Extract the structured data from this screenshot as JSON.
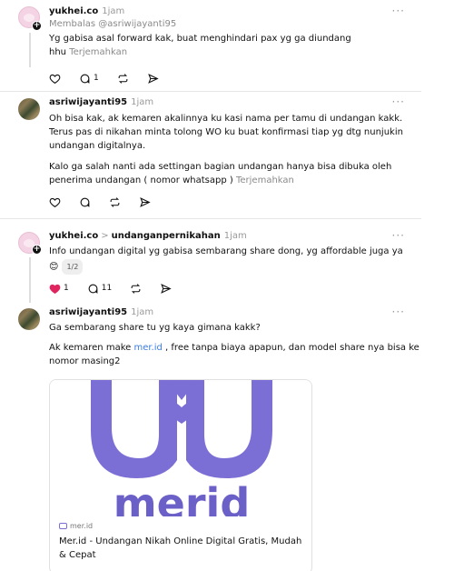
{
  "posts": [
    {
      "username": "yukhei.co",
      "time": "1jam",
      "reply_to": "Membalas @asriwijayanti95",
      "text_line1": "Yg gabisa asal forward kak, buat menghindari pax yg ga diundang",
      "text_line2": "hhu",
      "translate": "Terjemahkan",
      "reply_count": "1",
      "more": "···"
    },
    {
      "username": "asriwijayanti95",
      "time": "1jam",
      "p1_l1": "Oh bisa kak, ak kemaren akalinnya ku kasi nama per tamu di undangan kakk.",
      "p1_l2": "Terus pas di nikahan minta tolong WO ku buat konfirmasi tiap yg dtg nunjukin",
      "p1_l3": "undangan digitalnya.",
      "p2_l1": "Kalo ga salah nanti ada settingan bagian undangan hanya bisa dibuka oleh",
      "p2_l2": "penerima undangan ( nomor whatsapp )",
      "translate": "Terjemahkan",
      "more": "···"
    },
    {
      "username": "yukhei.co",
      "chevron": ">",
      "topic": "undanganpernikahan",
      "time": "1jam",
      "text": "Info undangan digital yg gabisa sembarang share dong, yg affordable juga ya",
      "emoji": "😊",
      "page_pill": "1/2",
      "like_count": "1",
      "reply_count": "11",
      "more": "···"
    },
    {
      "username": "asriwijayanti95",
      "time": "1jam",
      "p1": "Ga sembarang share tu yg kaya gimana kakk?",
      "p2_pre": "Ak kemaren make ",
      "p2_link": "mer.id",
      "p2_post": " , free tanpa biaya apapun, dan model share nya bisa ke",
      "p2_l2": "nomor masing2",
      "more": "···",
      "card": {
        "logo_text": "merid",
        "domain": "mer.id",
        "title_l1": "Mer.id - Undangan Nikah Online Digital Gratis, Mudah",
        "title_l2": "& Cepat"
      }
    }
  ],
  "colors": {
    "accent_link": "#3b7de1",
    "like_red": "#e0245e",
    "logo_purple": "#7b6fd6"
  },
  "icons": [
    "heart-icon",
    "comment-icon",
    "repost-icon",
    "share-icon",
    "more-icon",
    "plus-icon"
  ]
}
